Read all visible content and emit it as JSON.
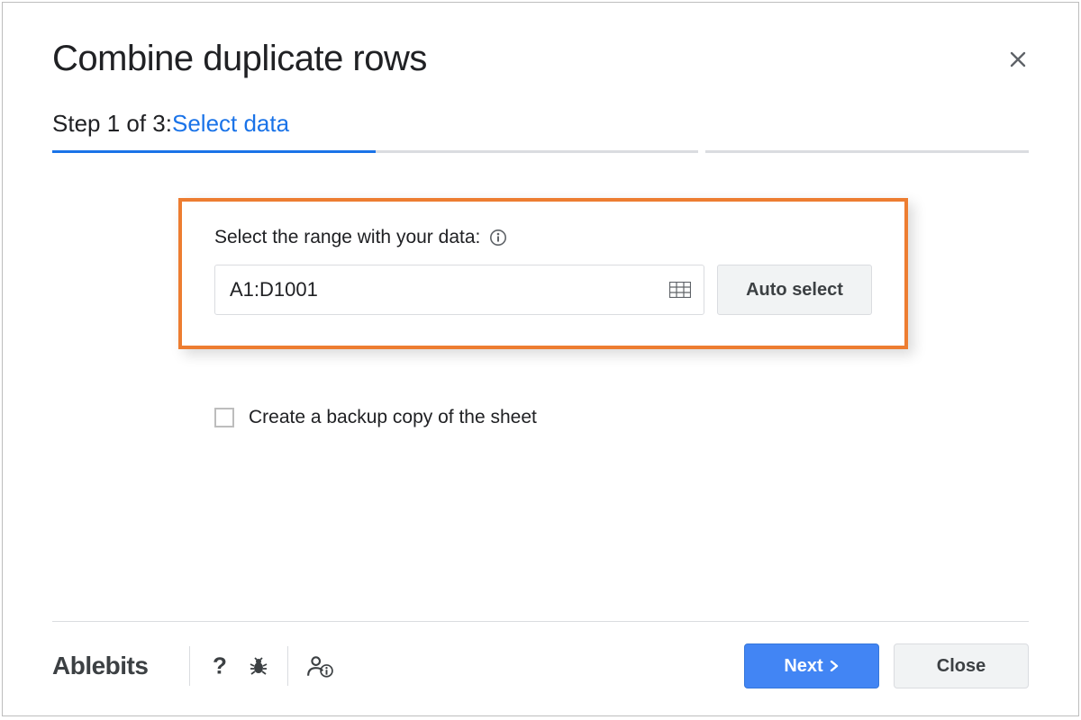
{
  "dialog": {
    "title": "Combine duplicate rows"
  },
  "step": {
    "prefix": "Step 1 of 3: ",
    "highlight": "Select data"
  },
  "range": {
    "label": "Select the range with your data:",
    "value": "A1:D1001",
    "auto_select_label": "Auto select"
  },
  "backup": {
    "label": "Create a backup copy of the sheet",
    "checked": false
  },
  "footer": {
    "brand": "Ablebits",
    "next_label": "Next",
    "close_label": "Close"
  }
}
